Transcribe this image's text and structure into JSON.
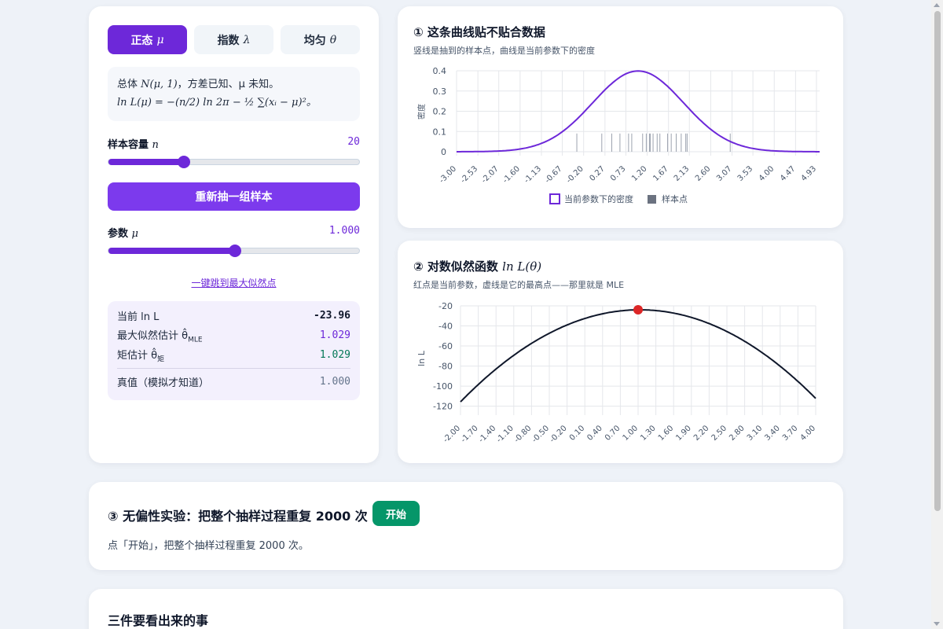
{
  "tabs": [
    {
      "label": "正态",
      "symbol": "μ",
      "active": true
    },
    {
      "label": "指数",
      "symbol": "λ",
      "active": false
    },
    {
      "label": "均匀",
      "symbol": "θ",
      "active": false
    }
  ],
  "formula": {
    "line1_prefix": "总体",
    "line1_dist": "N(μ, 1)",
    "line1_suffix": "，方差已知、μ 未知。",
    "line2": "ln L(μ) = −(n/2) ln 2π − ½ ∑(xᵢ − μ)²。"
  },
  "sample_size": {
    "label": "样本容量",
    "symbol": "n",
    "value": "20",
    "fraction": 0.3
  },
  "resample_button": "重新抽一组样本",
  "param": {
    "label": "参数",
    "symbol": "μ",
    "value": "1.000",
    "fraction": 0.5
  },
  "jump_link": "一键跳到最大似然点",
  "stats": {
    "current_lnL_label": "当前 ln L",
    "current_lnL": "-23.96",
    "mle_label": "最大似然估计 θ̂",
    "mle_sub": "MLE",
    "mle": "1.029",
    "mom_label": "矩估计 θ̂",
    "mom_sub": "矩",
    "mom": "1.029",
    "true_label": "真值（模拟才知道）",
    "true": "1.000"
  },
  "colors": {
    "accent": "#6d28d9",
    "mle": "#6d28d9",
    "mom": "#047857",
    "true": "#64748b",
    "start": "#059669",
    "point": "#dc2626"
  },
  "density_chart": {
    "title": "① 这条曲线贴不贴合数据",
    "subtitle": "竖线是抽到的样本点，曲线是当前参数下的密度"
  },
  "loglik_chart": {
    "title": "② 对数似然函数",
    "title_math": "ln L(θ)",
    "subtitle": "红点是当前参数，虚线是它的最高点——那里就是 MLE"
  },
  "chart_data": [
    {
      "type": "line",
      "ylabel": "密度",
      "x_tick_labels": [
        "-3.00",
        "-2.53",
        "-2.07",
        "-1.60",
        "-1.13",
        "-0.67",
        "-0.20",
        "0.27",
        "0.73",
        "1.20",
        "1.67",
        "2.13",
        "2.60",
        "3.07",
        "3.53",
        "4.00",
        "4.47",
        "4.93"
      ],
      "y_tick_labels": [
        "0",
        "0.1",
        "0.2",
        "0.3",
        "0.4"
      ],
      "xlim": [
        -3.0,
        5.0
      ],
      "ylim": [
        0,
        0.4
      ],
      "legend_position": "bottom",
      "series": [
        {
          "name": "当前参数下的密度",
          "mean": 1.0,
          "sd": 1.0,
          "color": "#6d28d9"
        },
        {
          "name": "样本点",
          "color": "#9ca3af",
          "values": [
            -0.35,
            0.2,
            0.42,
            0.6,
            0.79,
            0.86,
            1.1,
            1.18,
            1.25,
            1.27,
            1.33,
            1.42,
            1.48,
            1.65,
            1.73,
            1.84,
            1.95,
            2.05,
            2.08,
            3.03
          ]
        }
      ]
    },
    {
      "type": "line",
      "ylabel": "ln L",
      "x_tick_labels": [
        "-2.00",
        "-1.70",
        "-1.40",
        "-1.10",
        "-0.80",
        "-0.50",
        "-0.20",
        "0.10",
        "0.40",
        "0.70",
        "1.00",
        "1.30",
        "1.60",
        "1.90",
        "2.20",
        "2.50",
        "2.80",
        "3.10",
        "3.40",
        "3.70",
        "4.00"
      ],
      "y_tick_labels": [
        "-20",
        "-40",
        "-60",
        "-80",
        "-100",
        "-120"
      ],
      "xlim": [
        -2.0,
        4.0
      ],
      "ylim": [
        -125,
        -20
      ],
      "curve": {
        "mle": 1.029,
        "max_value": -23.95,
        "n": 20,
        "color": "#0f172a"
      },
      "current_point": {
        "x": 1.0,
        "y": -23.96
      }
    }
  ],
  "experiment": {
    "title": "③ 无偏性实验：把整个抽样过程重复 2000 次",
    "start_button": "开始",
    "description": "点「开始」，把整个抽样过程重复 2000 次。"
  },
  "notes": {
    "title": "三件要看出来的事"
  }
}
